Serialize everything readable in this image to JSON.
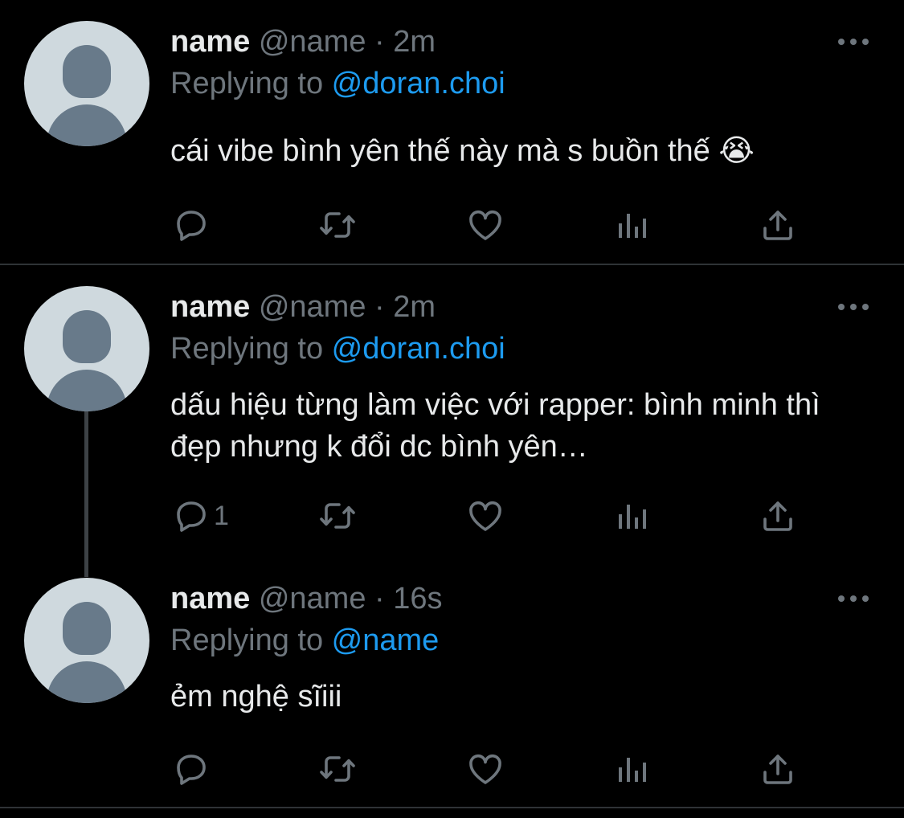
{
  "tweets": [
    {
      "name": "name",
      "handle_time": "@name · 2m",
      "replying_prefix": "Replying to ",
      "replying_to": "@doran.choi",
      "text": "cái vibe bình yên thế này mà s buồn thế 😭",
      "reply_count": ""
    },
    {
      "name": "name",
      "handle_time": "@name · 2m",
      "replying_prefix": "Replying to ",
      "replying_to": "@doran.choi",
      "text": "dấu hiệu từng làm việc với rapper: bình minh thì đẹp nhưng k đổi dc bình yên…",
      "reply_count": "1"
    },
    {
      "name": "name",
      "handle_time": "@name · 16s",
      "replying_prefix": "Replying to ",
      "replying_to": "@name",
      "text": "ẻm nghệ sĩiii",
      "reply_count": ""
    }
  ],
  "icons": {
    "reply": "reply-icon",
    "retweet": "retweet-icon",
    "like": "heart-icon",
    "analytics": "analytics-icon",
    "share": "share-icon",
    "more": "more-icon"
  },
  "colors": {
    "background": "#000000",
    "text": "#e7e9ea",
    "secondary": "#6e767d",
    "accent": "#1d9bf0",
    "divider": "#2f3336",
    "avatar_bg": "#cfd9de",
    "avatar_fg": "#687a8a"
  }
}
